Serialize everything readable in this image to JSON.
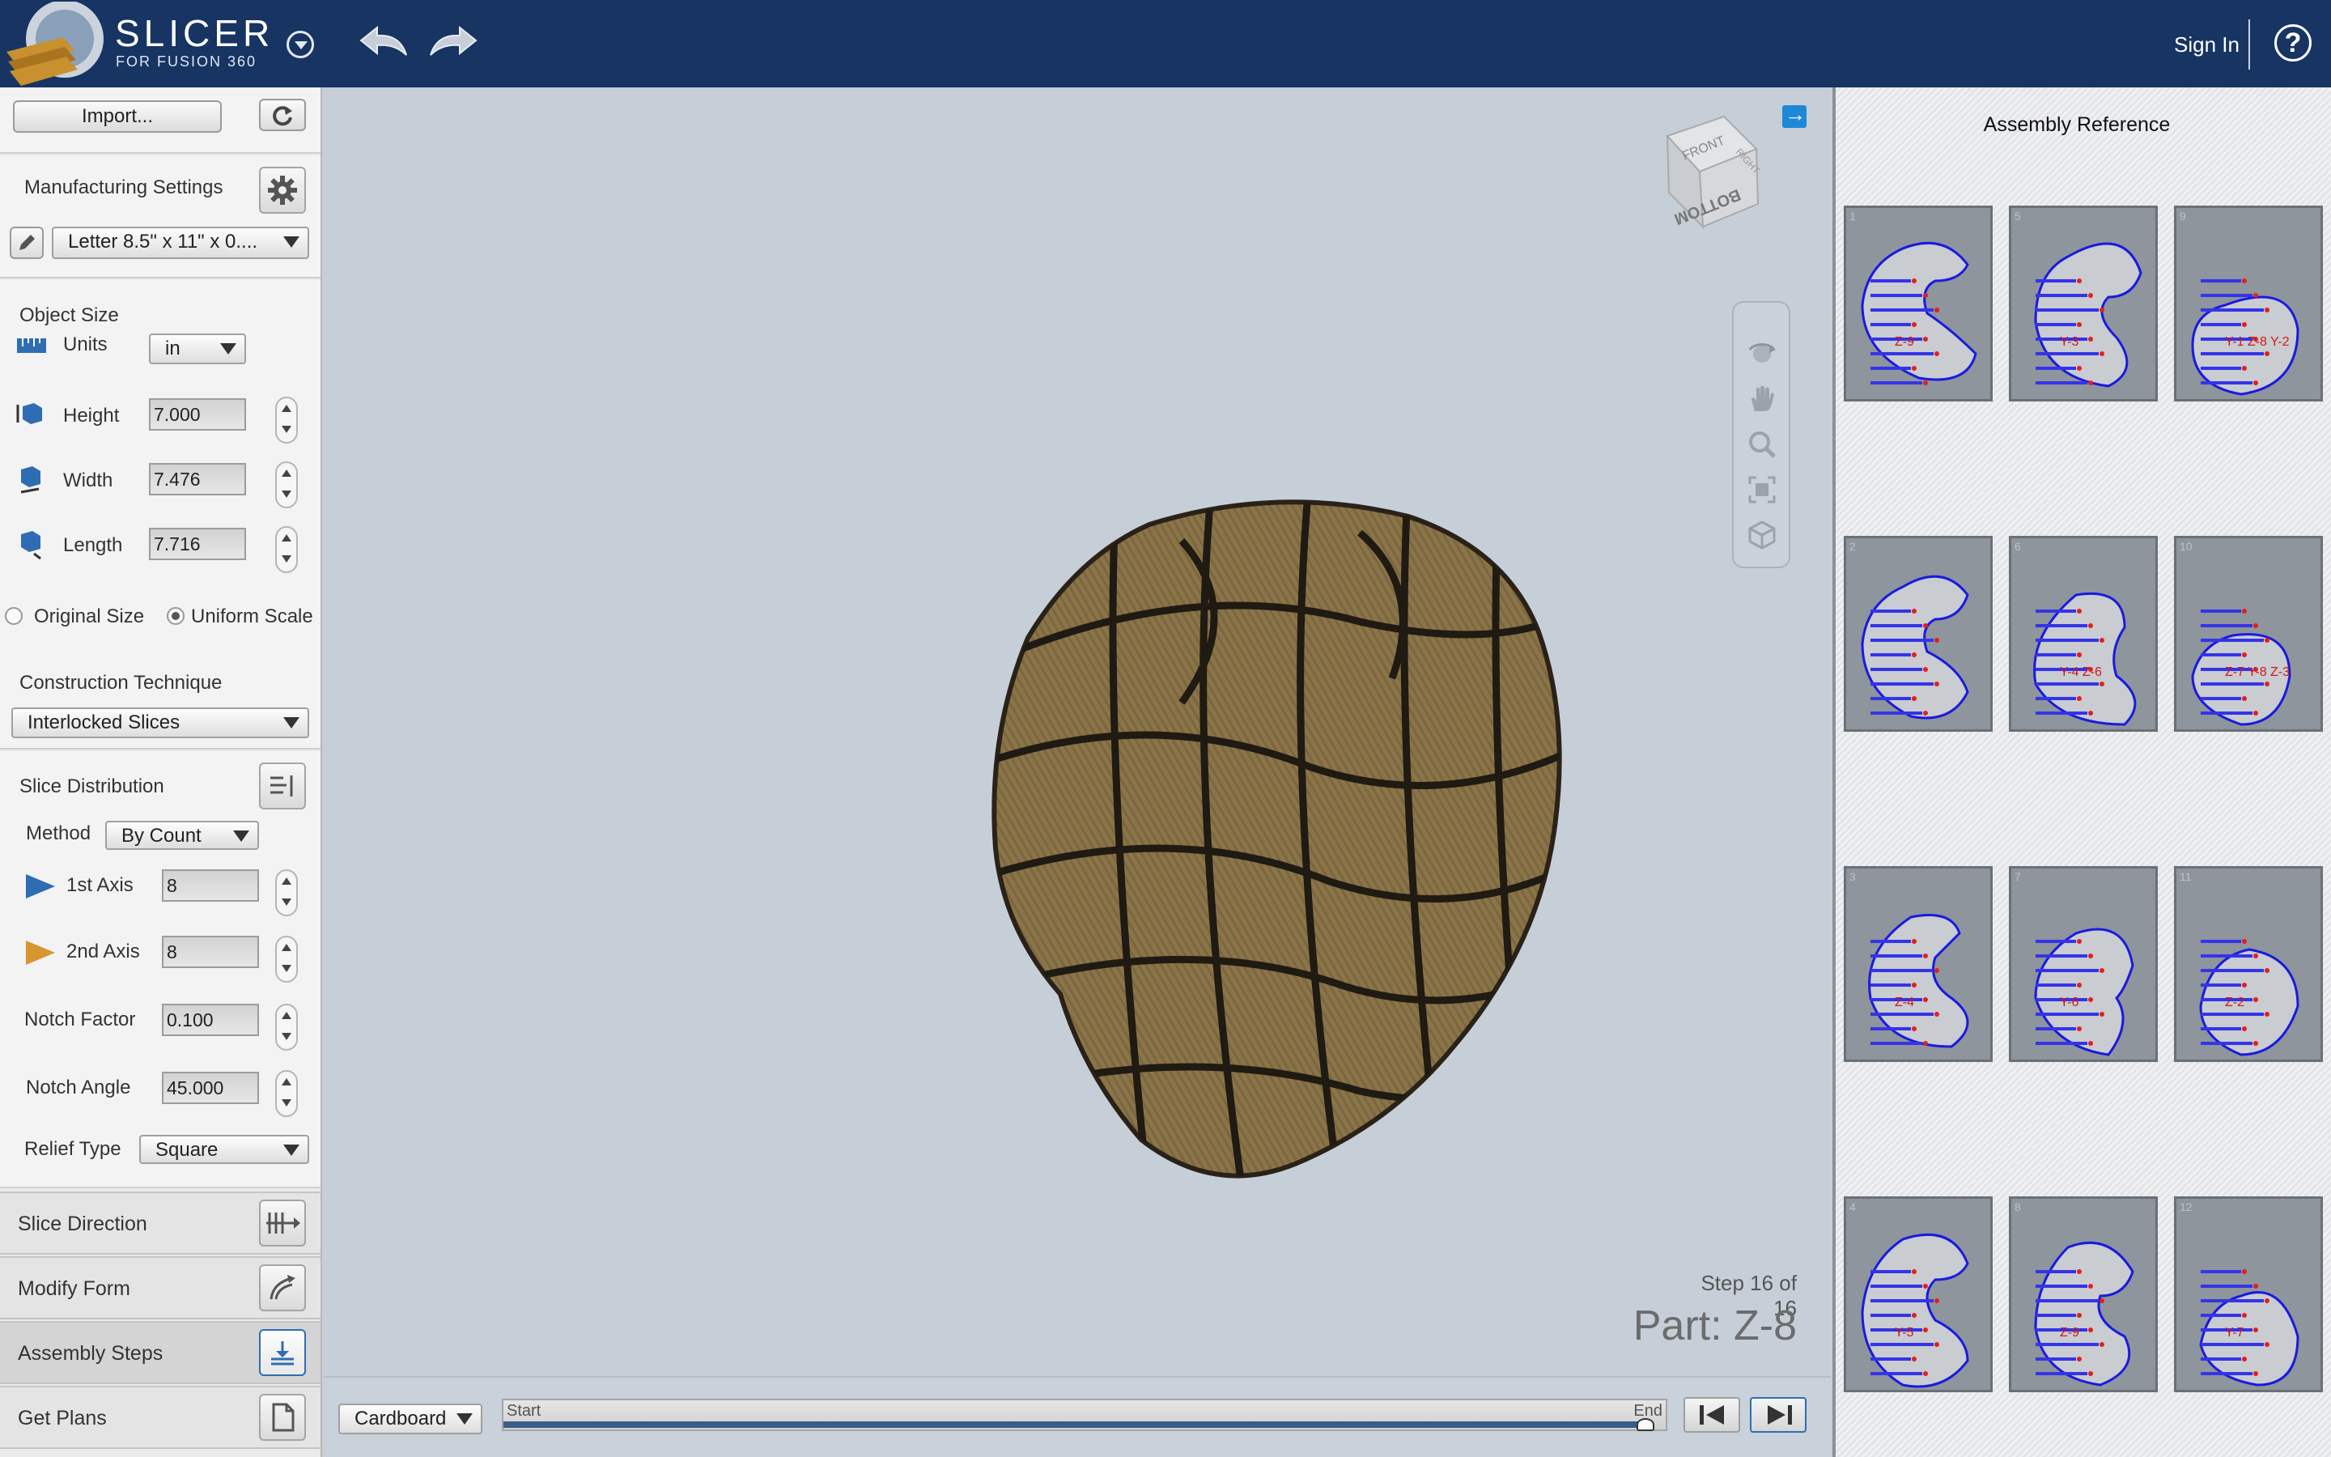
{
  "header": {
    "app_title": "SLICER",
    "app_subtitle": "FOR FUSION 360",
    "sign_in": "Sign In",
    "help": "?"
  },
  "left_panel": {
    "import_label": "Import...",
    "manufacturing_settings": "Manufacturing Settings",
    "material_preset": "Letter 8.5\" x 11\" x 0....",
    "object_size": {
      "title": "Object Size",
      "units_label": "Units",
      "units_value": "in",
      "height_label": "Height",
      "height_value": "7.000",
      "width_label": "Width",
      "width_value": "7.476",
      "length_label": "Length",
      "length_value": "7.716",
      "original_size": "Original Size",
      "uniform_scale": "Uniform Scale"
    },
    "construction": {
      "title": "Construction Technique",
      "value": "Interlocked Slices"
    },
    "slice_distribution": {
      "title": "Slice Distribution",
      "method_label": "Method",
      "method_value": "By Count",
      "axis1_label": "1st Axis",
      "axis1_value": "8",
      "axis2_label": "2nd Axis",
      "axis2_value": "8",
      "notch_factor_label": "Notch Factor",
      "notch_factor_value": "0.100",
      "notch_angle_label": "Notch Angle",
      "notch_angle_value": "45.000",
      "relief_type_label": "Relief Type",
      "relief_type_value": "Square"
    },
    "nav": {
      "slice_direction": "Slice Direction",
      "modify_form": "Modify Form",
      "assembly_steps": "Assembly Steps",
      "get_plans": "Get Plans"
    }
  },
  "viewport": {
    "viewcube_front": "FRONT",
    "viewcube_right": "RIGHT",
    "viewcube_bottom": "BOTTOM",
    "step_text": "Step 16 of 16",
    "part_text": "Part: Z-8",
    "model_color": "#8b7447"
  },
  "bottom_bar": {
    "material_value": "Cardboard",
    "slider_start": "Start",
    "slider_end": "End",
    "progress": 1.0
  },
  "assembly_reference": {
    "title": "Assembly Reference",
    "thumbnails": [
      {
        "num": "1",
        "label": "Z-9"
      },
      {
        "num": "5",
        "label": "Y-3"
      },
      {
        "num": "9",
        "label": "Y-1 Z-8 Y-2"
      },
      {
        "num": "2",
        "label": ""
      },
      {
        "num": "6",
        "label": "Y-4 Z-6"
      },
      {
        "num": "10",
        "label": "Z-7 Y-8 Z-3"
      },
      {
        "num": "3",
        "label": "Z-4"
      },
      {
        "num": "7",
        "label": "Y-6"
      },
      {
        "num": "11",
        "label": "Z-2"
      },
      {
        "num": "4",
        "label": "Y-5"
      },
      {
        "num": "8",
        "label": "Z-9"
      },
      {
        "num": "12",
        "label": "Y-7"
      }
    ]
  }
}
